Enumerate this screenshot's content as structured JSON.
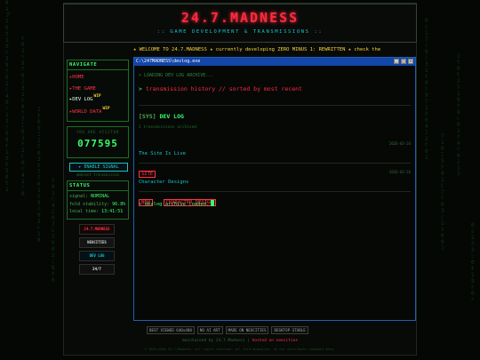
{
  "site": {
    "title": "24.7.MADNESS",
    "subtitle": ":: GAME DEVELOPMENT & TRANSMISSIONS ::"
  },
  "ticker": "★ WELCOME TO 24.7.MADNESS ★ currently developing ZERO MINUS 1: REWRITTEN ★ check the",
  "sidebar": {
    "nav_title": "NAVIGATE",
    "nav_items": [
      {
        "label": "▸HOME",
        "wip": ""
      },
      {
        "label": "▸THE GAME",
        "wip": ""
      },
      {
        "label": "▸DEV LOG",
        "wip": "WIP"
      },
      {
        "label": "▸WORLD DATA",
        "wip": "WIP"
      }
    ],
    "visitor_label": "YOU ARE VISITOR",
    "visitor_count": "077595",
    "signal_button": "▸ ENABLE SIGNAL",
    "signal_sub": "ambient transmission",
    "status_title": "STATUS",
    "status": {
      "signal_label": "signal:",
      "signal_value": "NOMINAL",
      "fold_label": "fold stability:",
      "fold_value": "96.8%",
      "time_label": "local time:",
      "time_value": "13:41:51"
    },
    "badges": [
      "24.7.MADNESS",
      "NEOCITIES",
      "DEV LOG",
      "24/7"
    ]
  },
  "window": {
    "title": "C:\\247MADNESS\\devlog.exe",
    "controls": [
      "_",
      "□",
      "×"
    ],
    "loading": "> LOADING DEV LOG ARCHIVE...",
    "command_prefix": ">",
    "command": "transmission history // sorted by most recent",
    "section_prefix": "[SYS]",
    "section_name": "DEV LOG",
    "section_sub": "2 transmissions archived",
    "entries": [
      {
        "title": "The Site Is Live",
        "date": "2026-03-26",
        "tags": [
          "SITE"
        ]
      },
      {
        "title": "Character Designs",
        "date": "2026-03-26",
        "tags": [
          "NEW",
          "CHARACTER DESIGN"
        ]
      }
    ],
    "prompt": "> devlog archive loaded."
  },
  "footer": {
    "buttons": [
      "BEST VIEWED 640x480",
      "NO AI ART",
      "MADE ON NEOCITIES",
      "DESKTOP STABLE"
    ],
    "credit_prefix": "maintained by 24.7.Madness |",
    "credit_link": "hosted on neocities",
    "copyright": "© 2025-2026 24.7.Madness. all rights reserved. all fold anomalies, do not distribute readable data."
  },
  "colors": {
    "accent_red": "#ff2a3d",
    "accent_green": "#39ff6a",
    "accent_cyan": "#19c3c8",
    "accent_yellow": "#ffd23a",
    "window_blue": "#1246a8"
  }
}
